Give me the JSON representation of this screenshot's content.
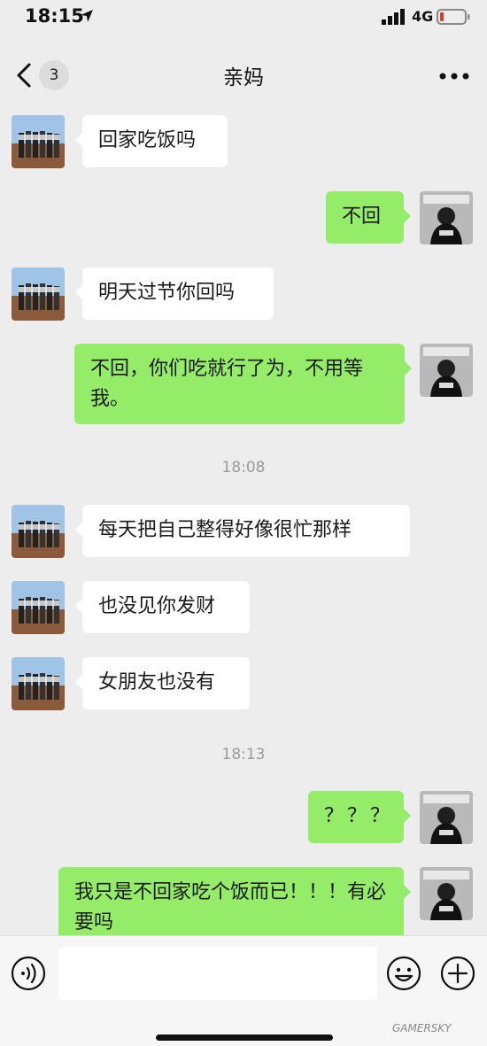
{
  "status_bar": {
    "time": "18:15",
    "network": "4G",
    "battery_color": "#e0362c"
  },
  "nav": {
    "back_badge": "3",
    "title": "亲妈"
  },
  "messages": [
    {
      "side": "in",
      "text": "回家吃饭吗"
    },
    {
      "side": "out",
      "text": "不回"
    },
    {
      "side": "in",
      "text": "明天过节你回吗"
    },
    {
      "side": "out",
      "text": "不回，你们吃就行了为，不用等我。"
    },
    {
      "side": "in",
      "text": "每天把自己整得好像很忙那样"
    },
    {
      "side": "in",
      "text": "也没见你发财"
    },
    {
      "side": "in",
      "text": "女朋友也没有"
    },
    {
      "side": "out",
      "text": "？？？"
    },
    {
      "side": "out",
      "text": "我只是不回家吃个饭而已！！！有必要吗"
    }
  ],
  "timestamps": [
    "18:08",
    "18:13"
  ],
  "input_bar": {
    "voice_icon": "voice-icon",
    "emoji_icon": "emoji-icon",
    "add_icon": "plus-icon",
    "input_value": ""
  },
  "watermark": "GAMERSKY",
  "colors": {
    "background": "#ededed",
    "bubble_out": "#95ec69",
    "bubble_in": "#ffffff"
  }
}
